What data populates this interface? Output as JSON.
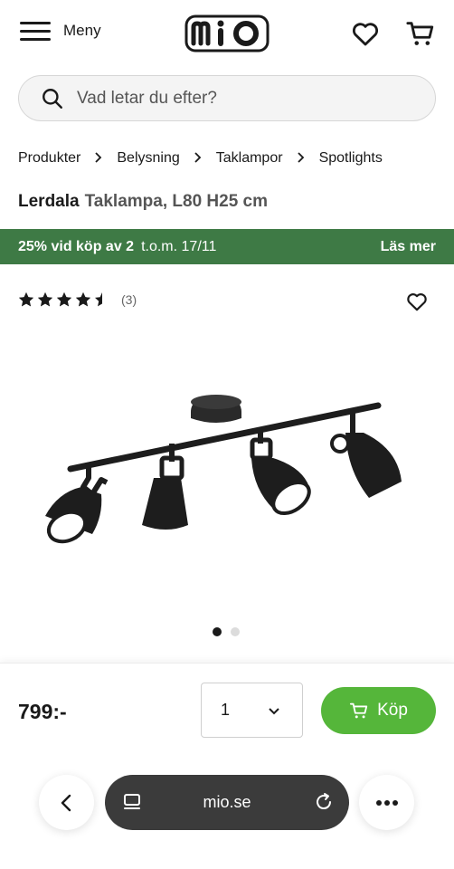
{
  "header": {
    "menu_label": "Meny",
    "logo_text": "mio"
  },
  "search": {
    "placeholder": "Vad letar du efter?"
  },
  "breadcrumb": [
    "Produkter",
    "Belysning",
    "Taklampor",
    "Spotlights"
  ],
  "product": {
    "brand": "Lerdala",
    "description": "Taklampa, L80 H25 cm",
    "rating": 4.5,
    "rating_count": "(3)",
    "price": "799:-"
  },
  "promo": {
    "deal": "25% vid köp av 2",
    "date": "t.o.m. 17/11",
    "more": "Läs mer",
    "color": "#3e7a45"
  },
  "carousel": {
    "images": 2,
    "active": 1
  },
  "purchase": {
    "quantity": "1",
    "buy_label": "Köp",
    "buy_color": "#55b63a"
  },
  "browser": {
    "url": "mio.se"
  }
}
